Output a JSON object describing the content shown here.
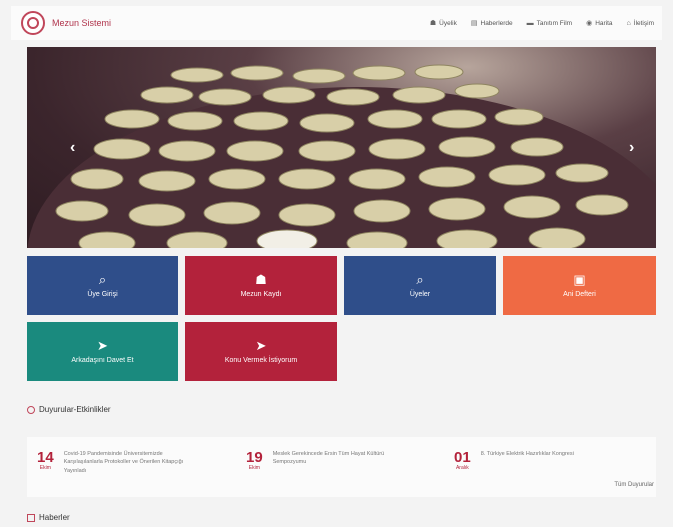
{
  "navbar": {
    "brand": "Mezun Sistemi",
    "items": [
      {
        "label": "Üyelik",
        "icon": "user-plus-icon"
      },
      {
        "label": "Haberlerde",
        "icon": "newspaper-icon"
      },
      {
        "label": "Tanıtım Film",
        "icon": "film-icon"
      },
      {
        "label": "Harita",
        "icon": "globe-icon"
      },
      {
        "label": "İletişim",
        "icon": "home-icon"
      }
    ]
  },
  "hero": {
    "prev": "‹",
    "next": "›"
  },
  "tiles": [
    {
      "label": "Üye Girişi",
      "icon": "search-icon"
    },
    {
      "label": "Mezun Kaydı",
      "icon": "add-user-icon"
    },
    {
      "label": "Üyeler",
      "icon": "search-icon"
    },
    {
      "label": "Ani Defteri",
      "icon": "book-icon"
    },
    {
      "label": "Arkadaşını Davet Et",
      "icon": "paper-plane-icon"
    },
    {
      "label": "Konu Vermek İstiyorum",
      "icon": "paper-plane-icon"
    }
  ],
  "sections": {
    "events_title": "Duyurular-Etkinlikler",
    "news_title": "Haberler"
  },
  "events": [
    {
      "day": "14",
      "month": "Ekim",
      "text": "Covid-19 Pandemisinde Üniversitemizde Karşılaşılanlarla Protokoller ve Önerilen Kitapçığı Yayınladı"
    },
    {
      "day": "19",
      "month": "Ekim",
      "text": "Meslek Gerekincede Ersin Tüm Hayat Kültürü Sempozyumu"
    },
    {
      "day": "01",
      "month": "Aralık",
      "text": "8. Türkiye Elektrik Hazırlıklar Kongresi"
    }
  ],
  "all_events": "Tüm Duyurular",
  "colors": {
    "blue": "#2f4e8a",
    "crimson": "#b3223b",
    "orange": "#ef6a44",
    "teal": "#1a8a7e"
  }
}
